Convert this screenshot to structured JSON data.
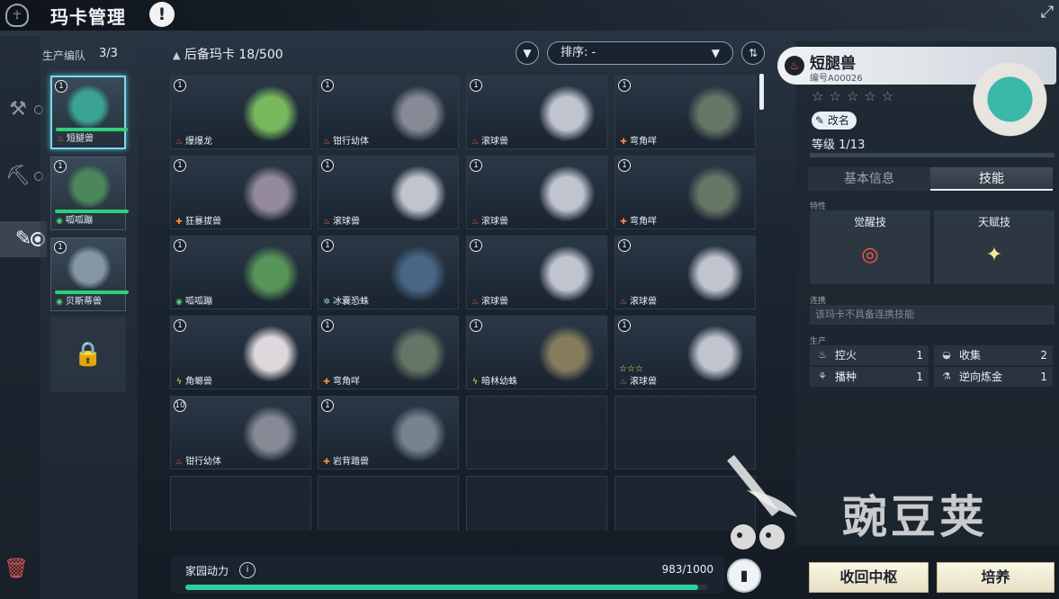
{
  "header": {
    "title": "玛卡管理",
    "logo_icon": "ritual-emblem-icon",
    "alert_icon": "exclamation-icon",
    "expand_icon": "expand-arrows-icon"
  },
  "siderail": {
    "icons": [
      "wrench-icon",
      "hammer-icon",
      "hand-tool-icon"
    ],
    "trash_icon": "trash-icon"
  },
  "team": {
    "label": "生产编队",
    "count": "3/3",
    "members": [
      {
        "level": "1",
        "name": "短腿兽",
        "element": "fire",
        "color": "#3aa898",
        "selected": true,
        "health": 1.0
      },
      {
        "level": "1",
        "name": "呱呱蹦",
        "element": "grass",
        "color": "#4e8a5a",
        "selected": false,
        "health": 1.0
      },
      {
        "level": "1",
        "name": "贝斯蒂兽",
        "element": "grass",
        "color": "#8a9aa8",
        "selected": false,
        "health": 1.0
      }
    ],
    "lock_icon": "lock-icon"
  },
  "reserve": {
    "label": "后备玛卡",
    "count": "18/500",
    "header_icon": "tent-icon"
  },
  "filter": {
    "filter_icon": "filter-icon",
    "sort_label": "排序: -",
    "sort_arrow_icon": "chevron-down-icon",
    "sort_dir_icon": "sort-order-icon"
  },
  "cards": [
    {
      "level": "1",
      "name": "爆爆龙",
      "element": "fire",
      "color": "#7cc060",
      "stars": ""
    },
    {
      "level": "1",
      "name": "钳行幼体",
      "element": "fire",
      "color": "#8a8f9a",
      "stars": ""
    },
    {
      "level": "1",
      "name": "滚球兽",
      "element": "fire",
      "color": "#c8ccd6",
      "stars": ""
    },
    {
      "level": "1",
      "name": "弯角咩",
      "element": "earth",
      "color": "#6a7a68",
      "stars": ""
    },
    {
      "level": "1",
      "name": "狂暴拔兽",
      "element": "earth",
      "color": "#9a8fa0",
      "stars": ""
    },
    {
      "level": "1",
      "name": "滚球兽",
      "element": "fire",
      "color": "#c8ccd6",
      "stars": ""
    },
    {
      "level": "1",
      "name": "滚球兽",
      "element": "fire",
      "color": "#c8ccd6",
      "stars": ""
    },
    {
      "level": "1",
      "name": "弯角咩",
      "element": "earth",
      "color": "#6a7a68",
      "stars": ""
    },
    {
      "level": "1",
      "name": "呱呱蹦",
      "element": "grass",
      "color": "#5a9a5a",
      "stars": ""
    },
    {
      "level": "1",
      "name": "冰囊恐蛛",
      "element": "ice",
      "color": "#4a6a8a",
      "stars": ""
    },
    {
      "level": "1",
      "name": "滚球兽",
      "element": "fire",
      "color": "#c8ccd6",
      "stars": ""
    },
    {
      "level": "1",
      "name": "滚球兽",
      "element": "fire",
      "color": "#c8ccd6",
      "stars": ""
    },
    {
      "level": "1",
      "name": "角螈兽",
      "element": "electric",
      "color": "#e8e0e4",
      "stars": ""
    },
    {
      "level": "1",
      "name": "弯角咩",
      "element": "earth",
      "color": "#6a7a68",
      "stars": ""
    },
    {
      "level": "1",
      "name": "暗林幼蛛",
      "element": "electric",
      "color": "#8a8060",
      "stars": ""
    },
    {
      "level": "1",
      "name": "滚球兽",
      "element": "fire",
      "color": "#c8ccd6",
      "stars": "☆☆☆"
    },
    {
      "level": "10",
      "name": "钳行幼体",
      "element": "fire",
      "color": "#8a8f9a",
      "stars": ""
    },
    {
      "level": "1",
      "name": "岩背踏兽",
      "element": "earth",
      "color": "#7a8894",
      "stars": ""
    }
  ],
  "power": {
    "label": "家园动力",
    "value": "983/1000",
    "progress": 0.983,
    "info_icon": "info-icon",
    "battery_icon": "battery-icon"
  },
  "detail": {
    "name": "短腿兽",
    "element_icon": "fire-icon",
    "id_label": "编号A00026",
    "stars": "☆☆☆☆☆",
    "rename_label": "改名",
    "rename_icon": "edit-icon",
    "level_label": "等级",
    "level_value": "1/13",
    "tabs": [
      "基本信息",
      "技能"
    ],
    "active_tab": 1,
    "traits_label": "特性",
    "skills": [
      {
        "title": "觉醒技",
        "icon": "awaken-ring-icon",
        "color": "#ff5a3a"
      },
      {
        "title": "天赋技",
        "icon": "sparkle-fire-icon",
        "color": "#f6e6a0"
      }
    ],
    "combo_label": "连携",
    "combo_text": "该玛卡不具备连携技能",
    "production_label": "生产",
    "production": [
      {
        "icon": "fire-icon",
        "label": "控火",
        "value": "1"
      },
      {
        "icon": "basket-icon",
        "label": "收集",
        "value": "2"
      },
      {
        "icon": "sprout-icon",
        "label": "播种",
        "value": "1"
      },
      {
        "icon": "flask-icon",
        "label": "逆向炼金",
        "value": "1"
      }
    ]
  },
  "actions": {
    "recall_label": "收回中枢",
    "nurture_label": "培养"
  },
  "watermark": {
    "text": "豌豆荚"
  }
}
